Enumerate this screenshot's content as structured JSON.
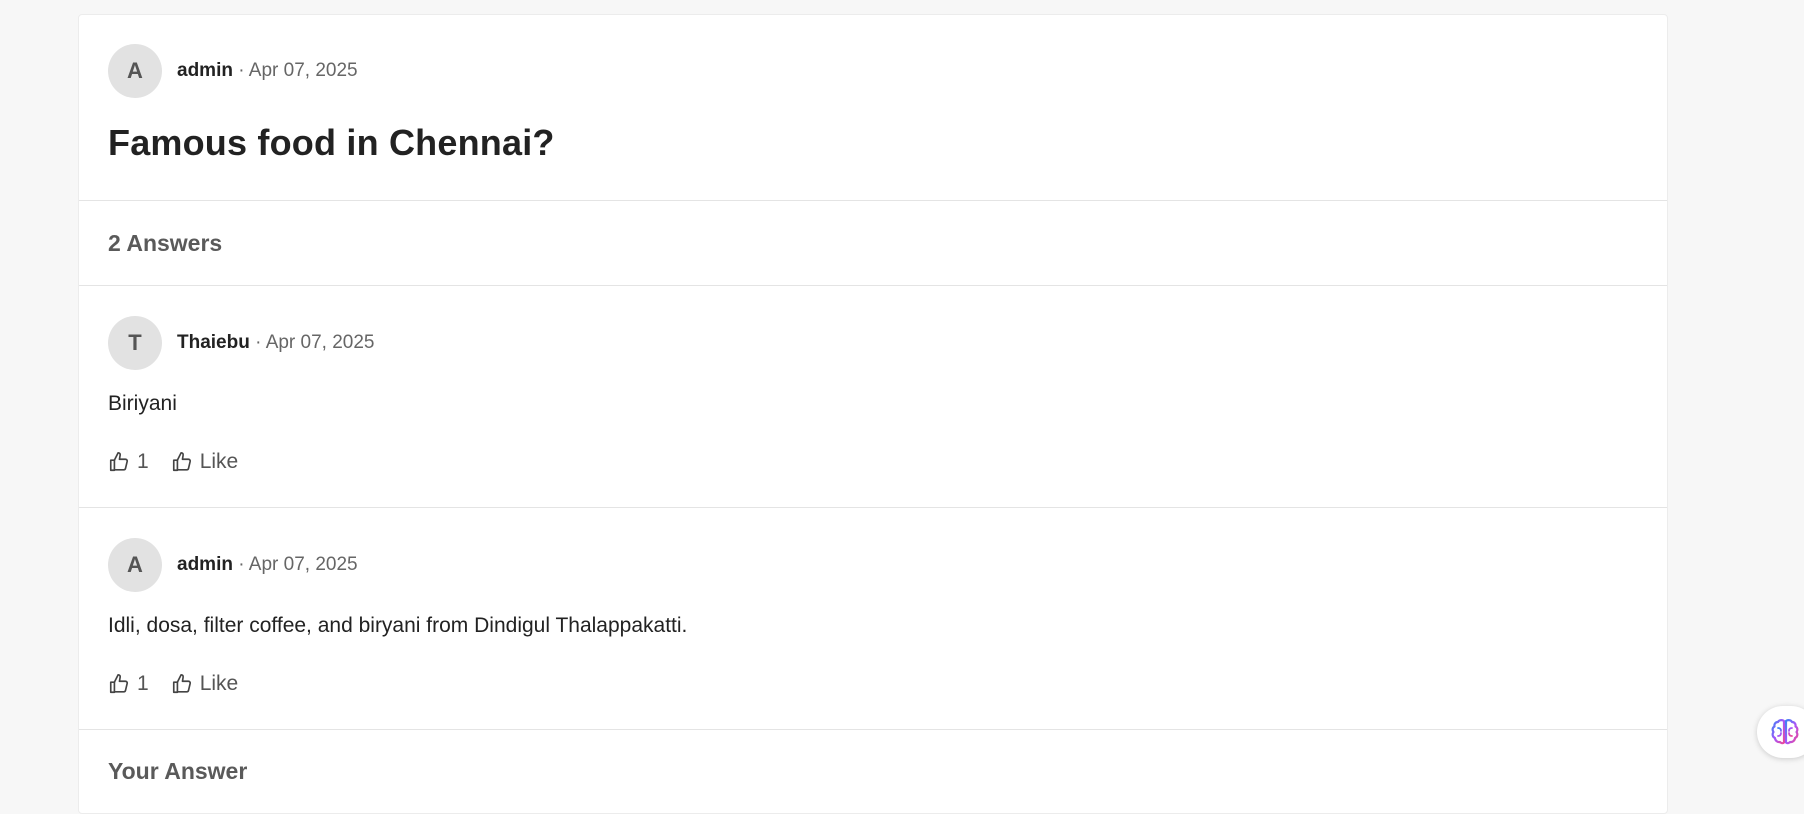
{
  "question": {
    "avatar_initial": "A",
    "author": "admin",
    "separator": " · ",
    "date": "Apr 07, 2025",
    "title": "Famous food in Chennai?"
  },
  "answers_heading": "2 Answers",
  "answers": [
    {
      "avatar_initial": "T",
      "author": "Thaiebu",
      "separator": " · ",
      "date": "Apr 07, 2025",
      "body": "Biriyani",
      "like_count": "1",
      "like_label": "Like"
    },
    {
      "avatar_initial": "A",
      "author": "admin",
      "separator": " · ",
      "date": "Apr 07, 2025",
      "body": "Idli, dosa, filter coffee, and biryani from Dindigul Thalappakatti.",
      "like_count": "1",
      "like_label": "Like"
    }
  ],
  "your_answer_heading": "Your Answer",
  "icons": {
    "like": "thumbs-up-icon",
    "assistant": "brain-icon"
  },
  "colors": {
    "background": "#f7f7f7",
    "card": "#ffffff",
    "avatar_bg": "#e2e2e2",
    "muted_text": "#666666"
  }
}
